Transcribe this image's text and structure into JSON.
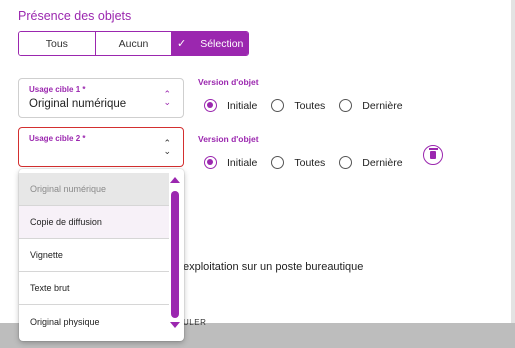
{
  "section": {
    "title": "Présence des objets"
  },
  "segmented": {
    "options": [
      "Tous",
      "Aucun",
      "Sélection"
    ],
    "check_icon": "✓",
    "active": "Sélection"
  },
  "field1": {
    "label": "Usage cible 1 *",
    "value": "Original numérique"
  },
  "field2": {
    "label": "Usage cible 2 *",
    "value": ""
  },
  "version1": {
    "label": "Version d'objet",
    "options": [
      "Initiale",
      "Toutes",
      "Dernière"
    ],
    "selected": "Initiale"
  },
  "version2": {
    "label": "Version d'objet",
    "options": [
      "Initiale",
      "Toutes",
      "Dernière"
    ],
    "selected": "Initiale"
  },
  "dropdown": {
    "options": [
      "Original numérique",
      "Copie de diffusion",
      "Vignette",
      "Texte brut",
      "Original physique"
    ],
    "selected": "Original numérique",
    "hovered": "Copie de diffusion"
  },
  "background": {
    "text1": "exploitation sur un poste bureautique",
    "text2": "ULER"
  },
  "colors": {
    "accent": "#9b27af",
    "error": "#d32f2f"
  },
  "icons": {
    "delete": "trash-icon",
    "sort": "chevron-updown-icon"
  }
}
